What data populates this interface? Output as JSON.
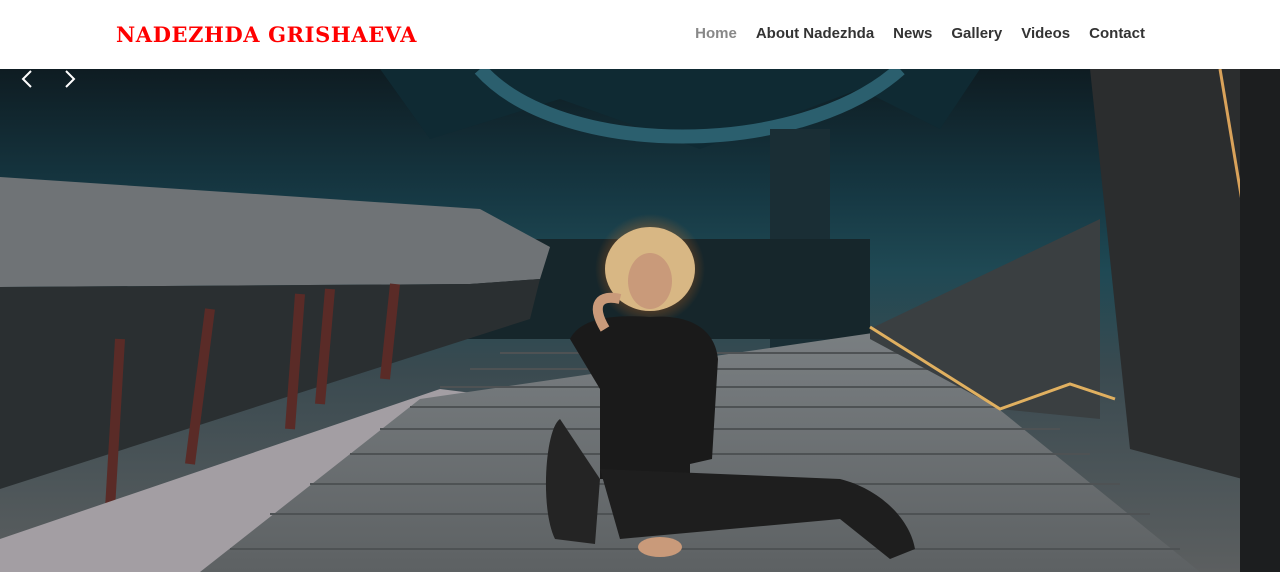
{
  "brand": {
    "name": "NADEZHDA GRISHAEVA",
    "color": "#ff0000"
  },
  "nav": {
    "items": [
      {
        "label": "Home",
        "active": true
      },
      {
        "label": "About Nadezhda",
        "active": false
      },
      {
        "label": "News",
        "active": false
      },
      {
        "label": "Gallery",
        "active": false
      },
      {
        "label": "Videos",
        "active": false
      },
      {
        "label": "Contact",
        "active": false
      }
    ]
  },
  "hero": {
    "image": "photo of a woman with curly blonde hair in black outfit sitting on concrete stairs in a dark teal interior",
    "controls": {
      "prev_icon": "chevron-left-icon",
      "next_icon": "chevron-right-icon"
    }
  }
}
